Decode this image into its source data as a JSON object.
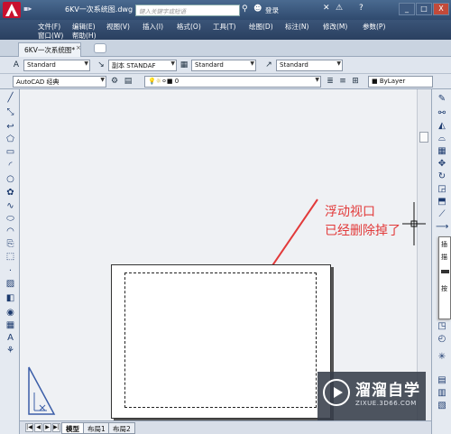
{
  "titlebar": {
    "quick_access": "▪▸",
    "doc_title": "6KV一次系统图.dwg",
    "search_placeholder": "键入关键字或短语",
    "login": "登录",
    "window_buttons": [
      "_",
      "□",
      "X"
    ]
  },
  "menubar": {
    "row1": [
      "文件(F)",
      "编辑(E)",
      "视图(V)",
      "插入(I)",
      "格式(O)",
      "工具(T)",
      "绘图(D)",
      "标注(N)",
      "修改(M)",
      "参数(P)"
    ],
    "row2": [
      "窗口(W)",
      "帮助(H)"
    ]
  },
  "doc_tabs": {
    "active_tab": "6KV一次系统图*",
    "close": "×"
  },
  "toolbar_styles": {
    "text_style": "Standard",
    "dim_style": "副本 STANDAF",
    "table_style": "Standard",
    "multileader_style": "Standard"
  },
  "toolbar_layers": {
    "workspace": "AutoCAD 经典",
    "layer": "0",
    "color": "ByLayer"
  },
  "annotation": {
    "line1": "浮动视口",
    "line2": "已经删除掉了"
  },
  "layout_tabs": {
    "model": "模型",
    "layout1": "布局1",
    "layout2": "布局2"
  },
  "flyout_items": [
    "插",
    "描",
    "",
    "按"
  ],
  "watermark": {
    "cn": "溜溜自学",
    "en": "ZIXUE.3D66.COM"
  },
  "colors": {
    "annotation_red": "#e23a3a",
    "title_bar": "#2f4a6e",
    "autocad_red": "#c8102e"
  }
}
